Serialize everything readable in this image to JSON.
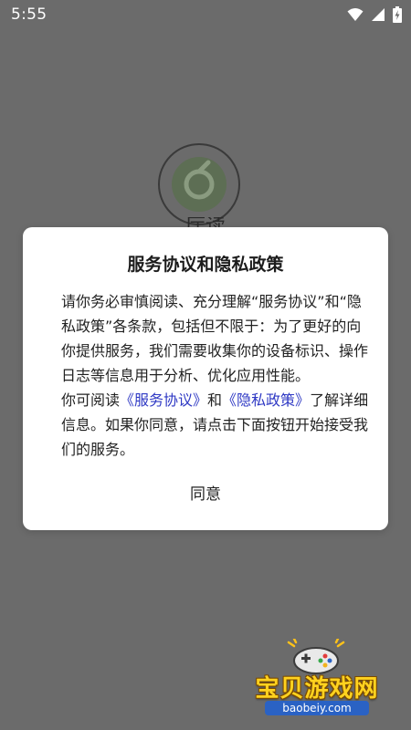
{
  "status_bar": {
    "time": "5:55",
    "icons": [
      "wifi-icon",
      "cellular-signal-icon",
      "battery-charging-icon"
    ]
  },
  "background": {
    "logo_icon": "app-logo-icon",
    "label_partial": "厅读"
  },
  "dialog": {
    "title": "服务协议和隐私政策",
    "body_paragraph_1": "请你务必审慎阅读、充分理解“服务协议”和“隐私政策”各条款，包括但不限于：为了更好的向你提供服务，我们需要收集你的设备标识、操作日志等信息用于分析、优化应用性能。",
    "body_p2_prefix": "你可阅读",
    "service_agreement_link": "《服务协议》",
    "body_p2_and": "和",
    "privacy_policy_link": "《隐私政策》",
    "body_p2_suffix": "了解详细信息。如果你同意，请点击下面按钮开始接受我们的服务。",
    "agree_label": "同意",
    "link_color": "#2f39c4"
  },
  "watermark": {
    "brand": "宝贝游戏网",
    "url": "baobeiy.com"
  }
}
